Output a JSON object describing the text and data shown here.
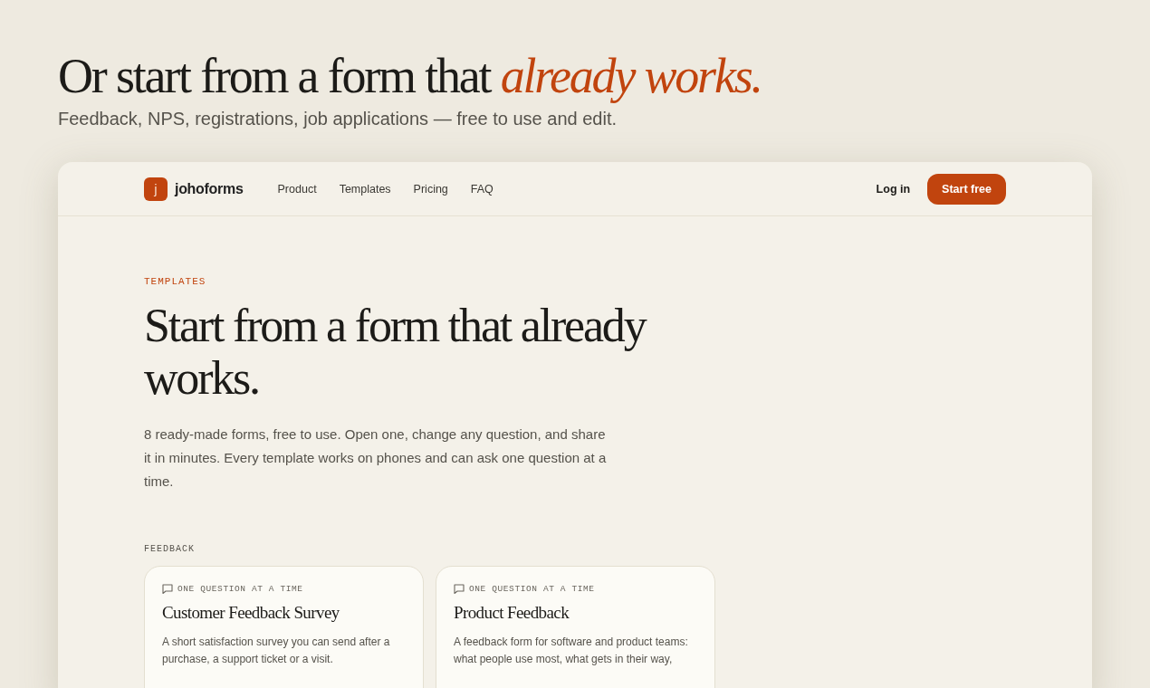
{
  "heading": "Or start from a form that *already works.*",
  "subheading": "Feedback, NPS, registrations, job applications — free to use and edit.",
  "site": {
    "logo_letter": "j",
    "brand": "johoforms",
    "nav": [
      "Product",
      "Templates",
      "Pricing",
      "FAQ"
    ],
    "login": "Log in",
    "cta": "Start free",
    "eyebrow": "TEMPLATES",
    "title": "Start from a form that already works.",
    "intro": "8 ready-made forms, free to use. Open one, change any question, and share it in minutes. Every template works on phones and can ask one question at a time.",
    "section": "FEEDBACK",
    "cards": [
      {
        "tag": "ONE QUESTION AT A TIME",
        "title": "Customer Feedback Survey",
        "description": "A short satisfaction survey you can send after a purchase, a support ticket or a visit."
      },
      {
        "tag": "ONE QUESTION AT A TIME",
        "title": "Product Feedback",
        "description": "A feedback form for software and product teams: what people use most, what gets in their way,"
      }
    ]
  }
}
